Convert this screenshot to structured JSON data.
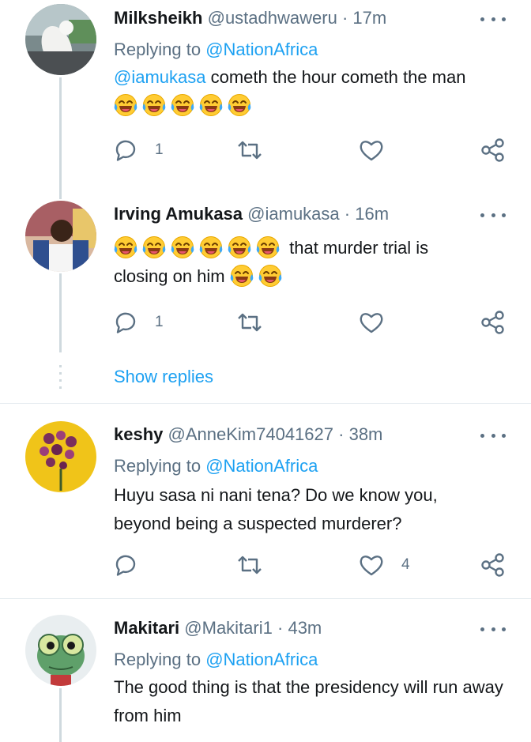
{
  "tweets": [
    {
      "name": "Milksheikh",
      "handle": "@ustadhwaweru",
      "time": "17m",
      "replying_label": "Replying to",
      "replying_to": "@NationAfrica",
      "mention": "@iamukasa",
      "text": "cometh the hour cometh the man",
      "emoji_count": 5,
      "reply_count": "1",
      "retweet_count": "",
      "like_count": ""
    },
    {
      "name": "Irving Amukasa",
      "handle": "@iamukasa",
      "time": "16m",
      "text_part1": "that murder trial is",
      "text_part2": "closing on him",
      "emoji_count_1": 6,
      "emoji_count_2": 2,
      "reply_count": "1",
      "retweet_count": "",
      "like_count": ""
    },
    {
      "name": "keshy",
      "handle": "@AnneKim74041627",
      "time": "38m",
      "replying_label": "Replying to",
      "replying_to": "@NationAfrica",
      "text": "Huyu sasa ni nani tena? Do we know you, beyond being a suspected murderer?",
      "reply_count": "",
      "retweet_count": "",
      "like_count": "4"
    },
    {
      "name": "Makitari",
      "handle": "@Makitari1",
      "time": "43m",
      "replying_label": "Replying to",
      "replying_to": "@NationAfrica",
      "text": "The good thing is that the presidency will run away from him"
    }
  ],
  "show_replies_label": "Show replies",
  "separator": "·",
  "colors": {
    "link": "#1da1f2",
    "muted": "#5b7083",
    "thread_line": "#cfd9de",
    "divider": "#e6ecf0"
  },
  "icons": [
    "reply-icon",
    "retweet-icon",
    "like-icon",
    "share-icon",
    "more-icon",
    "laughing-tears-emoji"
  ]
}
